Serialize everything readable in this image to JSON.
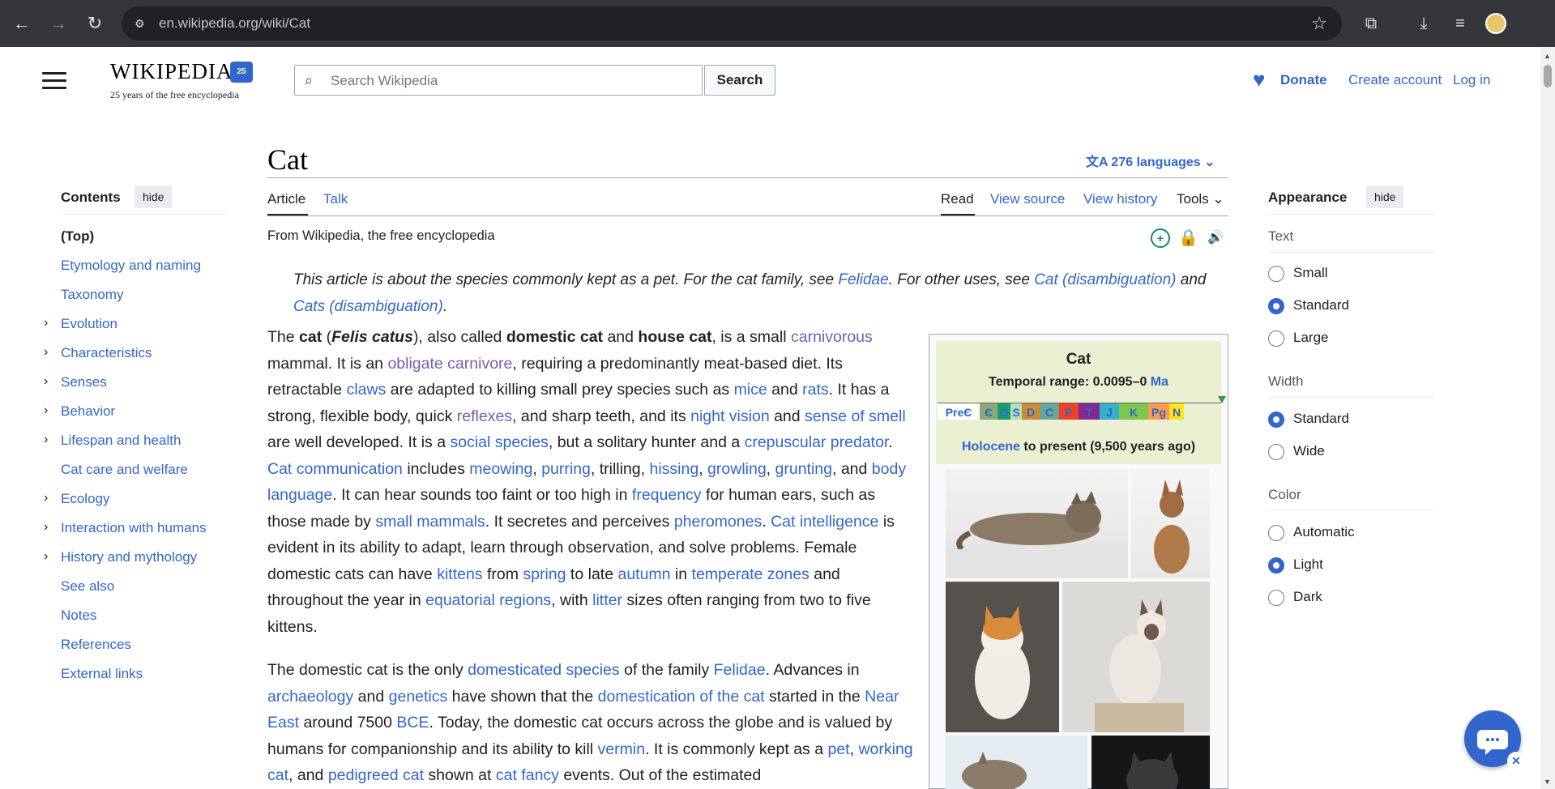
{
  "browser": {
    "url": "en.wikipedia.org/wiki/Cat"
  },
  "header": {
    "logo_word": "WIKIPEDIA",
    "logo_badge": "25",
    "tagline": "25 years of the free encyclopedia",
    "search_placeholder": "Search Wikipedia",
    "search_button": "Search",
    "donate": "Donate",
    "create_account": "Create account",
    "login": "Log in"
  },
  "page": {
    "title": "Cat",
    "languages": "276 languages",
    "tabs_left": [
      "Article",
      "Talk"
    ],
    "tabs_right": [
      "Read",
      "View source",
      "View history",
      "Tools"
    ],
    "from": "From Wikipedia, the free encyclopedia"
  },
  "toc": {
    "title": "Contents",
    "hide": "hide",
    "items": [
      {
        "label": "(Top)",
        "expandable": false
      },
      {
        "label": "Etymology and naming",
        "expandable": false
      },
      {
        "label": "Taxonomy",
        "expandable": false
      },
      {
        "label": "Evolution",
        "expandable": true
      },
      {
        "label": "Characteristics",
        "expandable": true
      },
      {
        "label": "Senses",
        "expandable": true
      },
      {
        "label": "Behavior",
        "expandable": true
      },
      {
        "label": "Lifespan and health",
        "expandable": true
      },
      {
        "label": "Cat care and welfare",
        "expandable": false
      },
      {
        "label": "Ecology",
        "expandable": true
      },
      {
        "label": "Interaction with humans",
        "expandable": true
      },
      {
        "label": "History and mythology",
        "expandable": true
      },
      {
        "label": "See also",
        "expandable": false
      },
      {
        "label": "Notes",
        "expandable": false
      },
      {
        "label": "References",
        "expandable": false
      },
      {
        "label": "External links",
        "expandable": false
      }
    ]
  },
  "appearance": {
    "title": "Appearance",
    "hide": "hide",
    "text_label": "Text",
    "text_options": [
      "Small",
      "Standard",
      "Large"
    ],
    "text_selected": "Standard",
    "width_label": "Width",
    "width_options": [
      "Standard",
      "Wide"
    ],
    "width_selected": "Standard",
    "color_label": "Color",
    "color_options": [
      "Automatic",
      "Light",
      "Dark"
    ],
    "color_selected": "Light"
  },
  "article": {
    "hatnote_parts": [
      {
        "t": "This article is about the species commonly kept as a pet. For the cat family, see "
      },
      {
        "t": "Felidae",
        "link": true
      },
      {
        "t": ". For other uses, see "
      },
      {
        "t": "Cat (disambiguation)",
        "link": true
      },
      {
        "t": " and "
      },
      {
        "t": "Cats (disambiguation)",
        "link": true
      },
      {
        "t": "."
      }
    ],
    "para1": [
      {
        "t": "The "
      },
      {
        "t": "cat",
        "b": true
      },
      {
        "t": " ("
      },
      {
        "t": "Felis catus",
        "b": true,
        "i": true
      },
      {
        "t": "), also called "
      },
      {
        "t": "domestic cat",
        "b": true
      },
      {
        "t": " and "
      },
      {
        "t": "house cat",
        "b": true
      },
      {
        "t": ", is a small "
      },
      {
        "t": "carnivorous",
        "link": true,
        "v": true
      },
      {
        "t": " mammal. It is an "
      },
      {
        "t": "obligate carnivore",
        "link": true,
        "v": true
      },
      {
        "t": ", requiring a predominantly meat-based diet. Its retractable "
      },
      {
        "t": "claws",
        "link": true
      },
      {
        "t": " are adapted to killing small prey species such as "
      },
      {
        "t": "mice",
        "link": true
      },
      {
        "t": " and "
      },
      {
        "t": "rats",
        "link": true
      },
      {
        "t": ". It has a strong, flexible body, quick "
      },
      {
        "t": "reflexes",
        "link": true,
        "v": true
      },
      {
        "t": ", and sharp teeth, and its "
      },
      {
        "t": "night vision",
        "link": true
      },
      {
        "t": " and "
      },
      {
        "t": "sense of smell",
        "link": true
      },
      {
        "t": " are well developed. It is a "
      },
      {
        "t": "social species",
        "link": true
      },
      {
        "t": ", but a solitary hunter and a "
      },
      {
        "t": "crepuscular predator",
        "link": true
      },
      {
        "t": ". "
      },
      {
        "t": "Cat communication",
        "link": true
      },
      {
        "t": " includes "
      },
      {
        "t": "meowing",
        "link": true
      },
      {
        "t": ", "
      },
      {
        "t": "purring",
        "link": true
      },
      {
        "t": ", trilling, "
      },
      {
        "t": "hissing",
        "link": true
      },
      {
        "t": ", "
      },
      {
        "t": "growling",
        "link": true
      },
      {
        "t": ", "
      },
      {
        "t": "grunting",
        "link": true
      },
      {
        "t": ", and "
      },
      {
        "t": "body language",
        "link": true
      },
      {
        "t": ". It can hear sounds too faint or too high in "
      },
      {
        "t": "frequency",
        "link": true
      },
      {
        "t": " for human ears, such as those made by "
      },
      {
        "t": "small mammals",
        "link": true
      },
      {
        "t": ". It secretes and perceives "
      },
      {
        "t": "pheromones",
        "link": true
      },
      {
        "t": ". "
      },
      {
        "t": "Cat intelligence",
        "link": true
      },
      {
        "t": " is evident in its ability to adapt, learn through observation, and solve problems. Female domestic cats can have "
      },
      {
        "t": "kittens",
        "link": true
      },
      {
        "t": " from "
      },
      {
        "t": "spring",
        "link": true
      },
      {
        "t": " to late "
      },
      {
        "t": "autumn",
        "link": true
      },
      {
        "t": " in "
      },
      {
        "t": "temperate zones",
        "link": true
      },
      {
        "t": " and throughout the year in "
      },
      {
        "t": "equatorial regions",
        "link": true
      },
      {
        "t": ", with "
      },
      {
        "t": "litter",
        "link": true
      },
      {
        "t": " sizes often ranging from two to five kittens."
      }
    ],
    "para2": [
      {
        "t": "The domestic cat is the only "
      },
      {
        "t": "domesticated species",
        "link": true
      },
      {
        "t": " of the family "
      },
      {
        "t": "Felidae",
        "link": true
      },
      {
        "t": ". Advances in "
      },
      {
        "t": "archaeology",
        "link": true
      },
      {
        "t": " and "
      },
      {
        "t": "genetics",
        "link": true
      },
      {
        "t": " have shown that the "
      },
      {
        "t": "domestication of the cat",
        "link": true
      },
      {
        "t": " started in the "
      },
      {
        "t": "Near East",
        "link": true
      },
      {
        "t": " around 7500 "
      },
      {
        "t": "BCE",
        "link": true
      },
      {
        "t": ". Today, the domestic cat occurs across the globe and is valued by humans for companionship and its ability to kill "
      },
      {
        "t": "vermin",
        "link": true
      },
      {
        "t": ". It is commonly kept as a "
      },
      {
        "t": "pet",
        "link": true
      },
      {
        "t": ", "
      },
      {
        "t": "working cat",
        "link": true
      },
      {
        "t": ", and "
      },
      {
        "t": "pedigreed cat",
        "link": true
      },
      {
        "t": " shown at "
      },
      {
        "t": "cat fancy",
        "link": true
      },
      {
        "t": " events. Out of the estimated"
      }
    ]
  },
  "infobox": {
    "name": "Cat",
    "range_prefix": "Temporal range: 0.0095–0 ",
    "range_unit": "Ma",
    "bar_labels": [
      "PreЄ",
      "Є",
      "O",
      "S",
      "D",
      "C",
      "P",
      "T",
      "J",
      "K",
      "Pg",
      "N"
    ],
    "bar_colors": [
      "#f5c2d9",
      "#8aab78",
      "#1a9d6f",
      "#b3e1b6",
      "#cb8c37",
      "#67a599",
      "#f04028",
      "#812b92",
      "#34b2c9",
      "#7fc64e",
      "#fd9a52",
      "#ffe619"
    ],
    "holocene": "Holocene",
    "holocene_rest": " to present (9,500 years ago)"
  },
  "colors": {
    "link": "#3366cc",
    "visited": "#795cb2",
    "chrome": "#35363a"
  }
}
